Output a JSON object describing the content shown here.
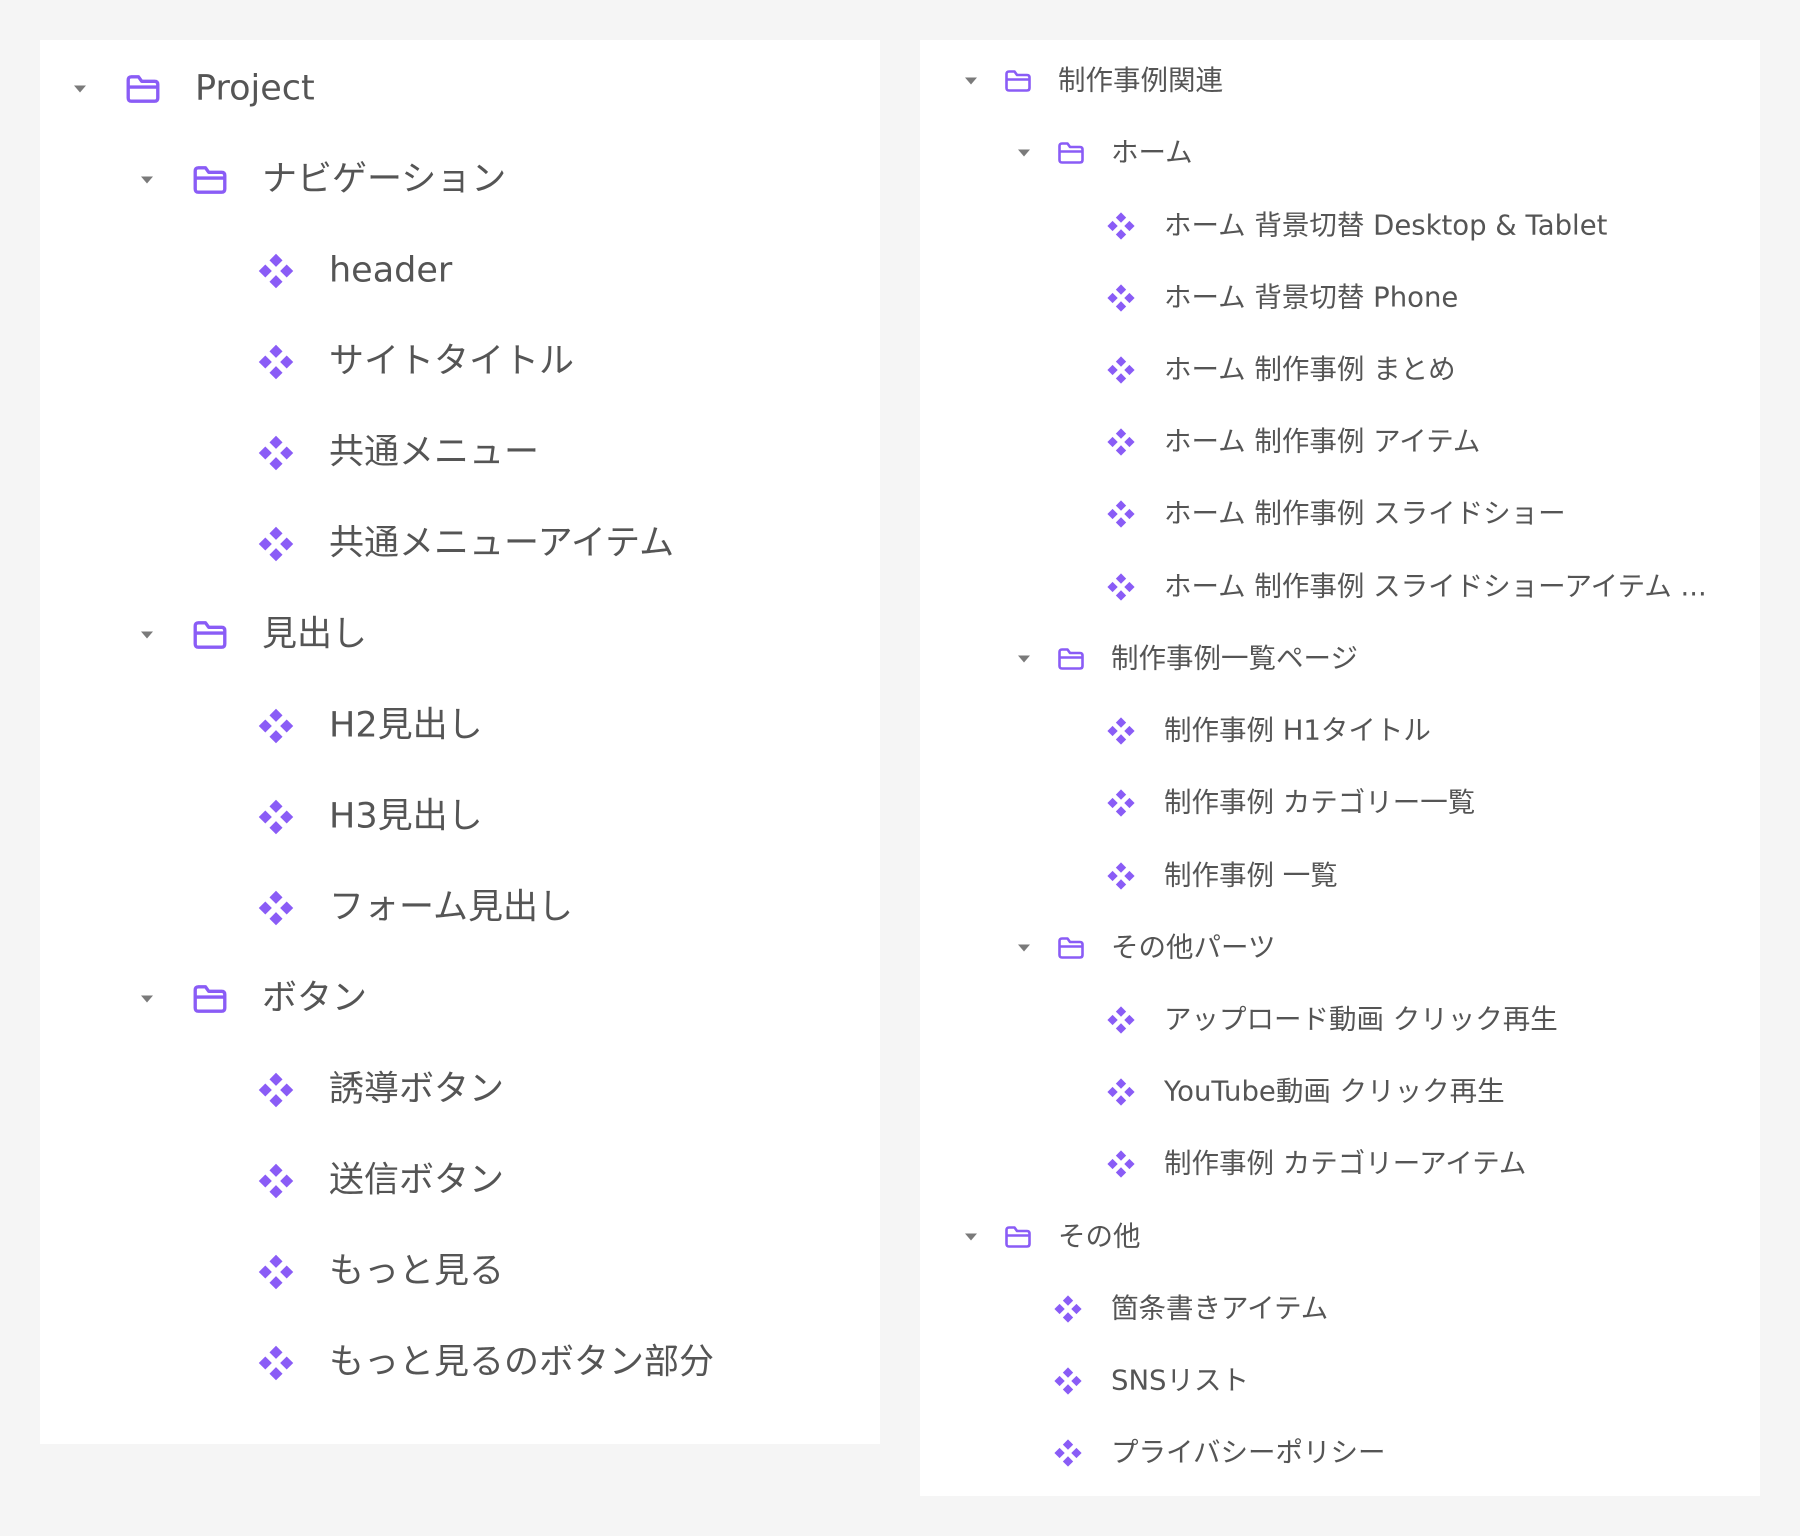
{
  "accent_color": "#8a5cf6",
  "icons": {
    "collapse_caret": "caret-down-icon",
    "folder": "folder-icon",
    "component": "component-icon"
  },
  "left_tree": {
    "root": {
      "label": "Project"
    },
    "groups": [
      {
        "label": "ナビゲーション",
        "items": [
          "header",
          "サイトタイトル",
          "共通メニュー",
          "共通メニューアイテム"
        ]
      },
      {
        "label": "見出し",
        "items": [
          "H2見出し",
          "H3見出し",
          "フォーム見出し"
        ]
      },
      {
        "label": "ボタン",
        "items": [
          "誘導ボタン",
          "送信ボタン",
          "もっと見る",
          "もっと見るのボタン部分"
        ]
      }
    ]
  },
  "right_tree": {
    "root1": {
      "label": "制作事例関連",
      "groups": [
        {
          "label": "ホーム",
          "items": [
            "ホーム 背景切替 Desktop & Tablet",
            "ホーム 背景切替 Phone",
            "ホーム 制作事例 まとめ",
            "ホーム 制作事例 アイテム",
            "ホーム 制作事例 スライドショー",
            "ホーム 制作事例 スライドショーアイテム ..."
          ]
        },
        {
          "label": "制作事例一覧ページ",
          "items": [
            "制作事例 H1タイトル",
            "制作事例 カテゴリー一覧",
            "制作事例 一覧"
          ]
        },
        {
          "label": "その他パーツ",
          "items": [
            "アップロード動画 クリック再生",
            "YouTube動画 クリック再生",
            "制作事例 カテゴリーアイテム"
          ]
        }
      ]
    },
    "root2": {
      "label": "その他",
      "items": [
        "箇条書きアイテム",
        "SNSリスト",
        "プライバシーポリシー"
      ]
    }
  }
}
